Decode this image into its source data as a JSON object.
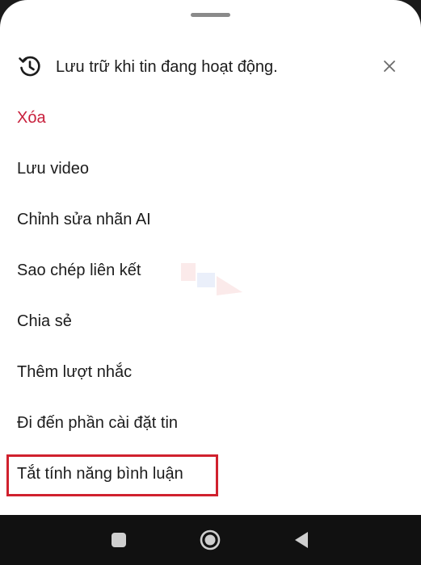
{
  "header": {
    "text": "Lưu trữ khi tin đang hoạt động.",
    "icon": "history-icon",
    "close_icon": "close-icon"
  },
  "menu": {
    "items": [
      {
        "label": "Xóa",
        "style": "danger"
      },
      {
        "label": "Lưu video"
      },
      {
        "label": "Chỉnh sửa nhãn AI"
      },
      {
        "label": "Sao chép liên kết"
      },
      {
        "label": "Chia sẻ"
      },
      {
        "label": "Thêm lượt nhắc"
      },
      {
        "label": "Đi đến phần cài đặt tin"
      },
      {
        "label": "Tắt tính năng bình luận"
      }
    ]
  },
  "navbar": {
    "icons": [
      "recents-square-icon",
      "home-circle-icon",
      "back-triangle-icon"
    ]
  },
  "colors": {
    "danger": "#c8203c",
    "highlight": "#d0212e",
    "text": "#1c1c1c",
    "navbar": "#111111"
  }
}
